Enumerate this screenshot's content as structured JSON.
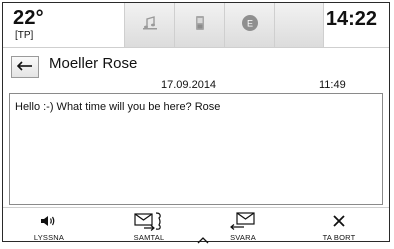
{
  "status_bar": {
    "temperature": "22°",
    "temperature_mode": "[TP]",
    "clock": "14:22",
    "tabs": [
      {
        "icon": "music-icon"
      },
      {
        "icon": "phone-icon"
      },
      {
        "icon": "e-mode-icon",
        "label": "E"
      }
    ]
  },
  "message": {
    "sender": "Moeller Rose",
    "date": "17.09.2014",
    "time": "11:49",
    "body": "Hello :-) What time will you be here? Rose"
  },
  "actions": [
    {
      "label": "LYSSNA",
      "icon": "speaker-icon"
    },
    {
      "label": "SAMTAL",
      "icon": "envelope-call-icon"
    },
    {
      "label": "SVARA",
      "icon": "reply-envelope-icon"
    },
    {
      "label": "TA BORT",
      "icon": "close-icon"
    }
  ],
  "colors": {
    "accent": "#111111",
    "tab_gradient_top": "#f2f2f2",
    "tab_gradient_bottom": "#dcdcdc"
  }
}
